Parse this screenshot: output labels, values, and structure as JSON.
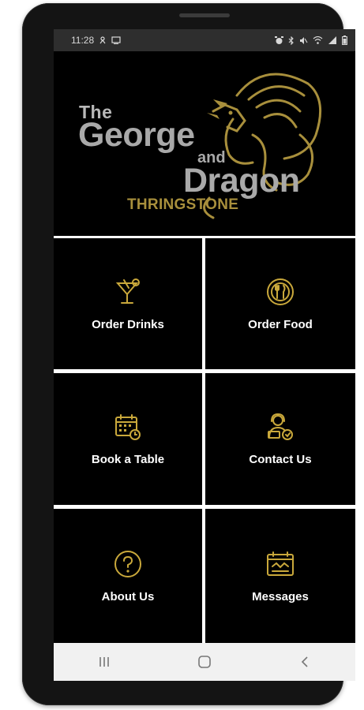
{
  "status_bar": {
    "time": "11:28",
    "left_icons": [
      "notification-icon",
      "screenshot-icon"
    ],
    "right_icons": [
      "alarm-icon",
      "bluetooth-icon",
      "mute-icon",
      "wifi-icon",
      "signal-icon",
      "battery-icon"
    ]
  },
  "header": {
    "logo_the": "The",
    "logo_george": "George",
    "logo_and": "and",
    "logo_dragon": "Dragon",
    "logo_place": "THRINGSTONE",
    "accent_color": "#a88f3c"
  },
  "menu": [
    {
      "label": "Order Drinks",
      "icon": "cocktail-icon"
    },
    {
      "label": "Order Food",
      "icon": "plate-cutlery-icon"
    },
    {
      "label": "Book a Table",
      "icon": "calendar-clock-icon"
    },
    {
      "label": "Contact Us",
      "icon": "support-agent-icon"
    },
    {
      "label": "About Us",
      "icon": "question-circle-icon"
    },
    {
      "label": "Messages",
      "icon": "calendar-messages-icon"
    }
  ],
  "nav_bar": {
    "buttons": [
      "recents-icon",
      "home-icon",
      "back-icon"
    ]
  },
  "colors": {
    "background": "#000000",
    "grid_lines": "#ffffff",
    "icon_gold": "#c9a83b",
    "status_bar": "#2e2e2e",
    "nav_bar": "#f1f1f1"
  }
}
